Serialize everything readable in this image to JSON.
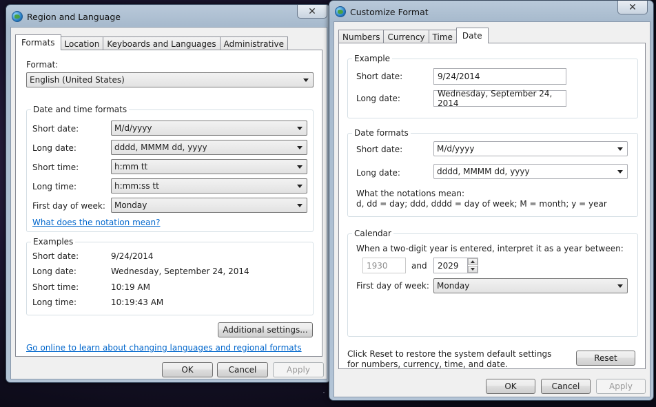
{
  "region": {
    "title": "Region and Language",
    "close": "✕",
    "tabs": [
      "Formats",
      "Location",
      "Keyboards and Languages",
      "Administrative"
    ],
    "format_label": "Format:",
    "format_value": "English (United States)",
    "dt_group": "Date and time formats",
    "rows": [
      {
        "label": "Short date:",
        "value": "M/d/yyyy"
      },
      {
        "label": "Long date:",
        "value": "dddd, MMMM dd, yyyy"
      },
      {
        "label": "Short time:",
        "value": "h:mm tt"
      },
      {
        "label": "Long time:",
        "value": "h:mm:ss tt"
      },
      {
        "label": "First day of week:",
        "value": "Monday"
      }
    ],
    "notation_link": "What does the notation mean?",
    "examples_group": "Examples",
    "examples": [
      {
        "label": "Short date:",
        "value": "9/24/2014"
      },
      {
        "label": "Long date:",
        "value": "Wednesday, September 24, 2014"
      },
      {
        "label": "Short time:",
        "value": "10:19 AM"
      },
      {
        "label": "Long time:",
        "value": "10:19:43 AM"
      }
    ],
    "additional_settings": "Additional settings...",
    "online_link": "Go online to learn about changing languages and regional formats",
    "ok": "OK",
    "cancel": "Cancel",
    "apply": "Apply"
  },
  "customize": {
    "title": "Customize Format",
    "close": "✕",
    "tabs": [
      "Numbers",
      "Currency",
      "Time",
      "Date"
    ],
    "example_group": "Example",
    "example_short_label": "Short date:",
    "example_short_value": "9/24/2014",
    "example_long_label": "Long date:",
    "example_long_value": "Wednesday, September 24, 2014",
    "formats_group": "Date formats",
    "short_label": "Short date:",
    "short_value": "M/d/yyyy",
    "long_label": "Long date:",
    "long_value": "dddd, MMMM dd, yyyy",
    "notation_title": "What the notations mean:",
    "notation_text": "d, dd = day;  ddd, dddd = day of week;  M = month;  y = year",
    "calendar_group": "Calendar",
    "twodigit_text": "When a two-digit year is entered, interpret it as a year between:",
    "year_from": "1930",
    "and_text": "and",
    "year_to": "2029",
    "first_day_label": "First day of week:",
    "first_day_value": "Monday",
    "reset_text": "Click Reset to restore the system default settings for numbers, currency, time, and date.",
    "reset": "Reset",
    "ok": "OK",
    "cancel": "Cancel",
    "apply": "Apply"
  }
}
